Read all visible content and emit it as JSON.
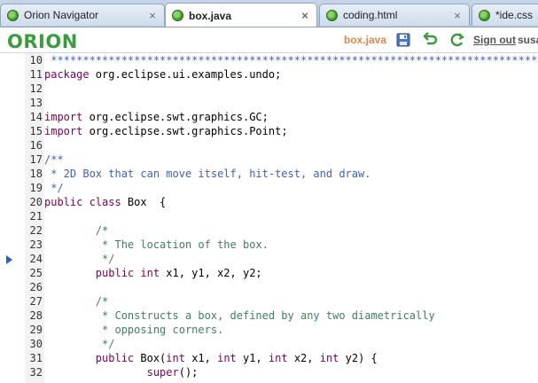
{
  "browser": {
    "tabs": [
      {
        "label": "Orion Navigator",
        "active": false,
        "close": "×"
      },
      {
        "label": "box.java",
        "active": true,
        "close": "×"
      },
      {
        "label": "coding.html",
        "active": false,
        "close": "×"
      },
      {
        "label": "*ide.css",
        "active": false,
        "close": "×"
      }
    ]
  },
  "banner": {
    "logo": "ORION",
    "file_name": "box.java",
    "sign_out": "Sign out",
    "user": "susan"
  },
  "icons": {
    "save": "save-icon",
    "undo": "undo-icon",
    "refresh": "refresh-icon",
    "globe": "globe-icon",
    "ruler_marker": "ruler-marker-icon"
  },
  "colors": {
    "keyword": "#7f0055",
    "comment": "#3f7f5f",
    "javadoc": "#3f5fbf",
    "logo": "#3c9b3c",
    "file_name": "#e8814a"
  },
  "editor": {
    "lines": [
      {
        "n": "10",
        "segs": [
          {
            "t": " ******************************************************************************",
            "c": "d"
          }
        ]
      },
      {
        "n": "11",
        "segs": [
          {
            "t": "package",
            "c": "k"
          },
          {
            "t": " org.eclipse.ui.examples.undo;",
            "c": "n"
          }
        ]
      },
      {
        "n": "12",
        "segs": []
      },
      {
        "n": "13",
        "segs": []
      },
      {
        "n": "14",
        "segs": [
          {
            "t": "import",
            "c": "k"
          },
          {
            "t": " org.eclipse.swt.graphics.GC;",
            "c": "n"
          }
        ]
      },
      {
        "n": "15",
        "segs": [
          {
            "t": "import",
            "c": "k"
          },
          {
            "t": " org.eclipse.swt.graphics.Point;",
            "c": "n"
          }
        ]
      },
      {
        "n": "16",
        "segs": []
      },
      {
        "n": "17",
        "segs": [
          {
            "t": "/**",
            "c": "d"
          }
        ]
      },
      {
        "n": "18",
        "segs": [
          {
            "t": " * 2D Box that can move itself, hit-test, and draw.",
            "c": "d"
          }
        ]
      },
      {
        "n": "19",
        "segs": [
          {
            "t": " */",
            "c": "d"
          }
        ]
      },
      {
        "n": "20",
        "segs": [
          {
            "t": "public class",
            "c": "k"
          },
          {
            "t": " Box  {",
            "c": "n"
          }
        ]
      },
      {
        "n": "21",
        "segs": []
      },
      {
        "n": "22",
        "segs": [
          {
            "t": "        /*",
            "c": "c"
          }
        ]
      },
      {
        "n": "23",
        "segs": [
          {
            "t": "         * The location of the box.",
            "c": "c"
          }
        ]
      },
      {
        "n": "24",
        "segs": [
          {
            "t": "         */",
            "c": "c"
          }
        ]
      },
      {
        "n": "25",
        "segs": [
          {
            "t": "        ",
            "c": "n"
          },
          {
            "t": "public int",
            "c": "k"
          },
          {
            "t": " x1, y1, x2, y2;",
            "c": "n"
          }
        ]
      },
      {
        "n": "26",
        "segs": []
      },
      {
        "n": "27",
        "segs": [
          {
            "t": "        /*",
            "c": "c"
          }
        ]
      },
      {
        "n": "28",
        "segs": [
          {
            "t": "         * Constructs a box, defined by any two diametrically",
            "c": "c"
          }
        ]
      },
      {
        "n": "29",
        "segs": [
          {
            "t": "         * opposing corners.",
            "c": "c"
          }
        ]
      },
      {
        "n": "30",
        "segs": [
          {
            "t": "         */",
            "c": "c"
          }
        ]
      },
      {
        "n": "31",
        "segs": [
          {
            "t": "        ",
            "c": "n"
          },
          {
            "t": "public",
            "c": "k"
          },
          {
            "t": " Box(",
            "c": "n"
          },
          {
            "t": "int",
            "c": "k"
          },
          {
            "t": " x1, ",
            "c": "n"
          },
          {
            "t": "int",
            "c": "k"
          },
          {
            "t": " y1, ",
            "c": "n"
          },
          {
            "t": "int",
            "c": "k"
          },
          {
            "t": " x2, ",
            "c": "n"
          },
          {
            "t": "int",
            "c": "k"
          },
          {
            "t": " y2) {",
            "c": "n"
          }
        ]
      },
      {
        "n": "32",
        "segs": [
          {
            "t": "                ",
            "c": "n"
          },
          {
            "t": "super",
            "c": "k"
          },
          {
            "t": "();",
            "c": "n"
          }
        ]
      }
    ]
  }
}
